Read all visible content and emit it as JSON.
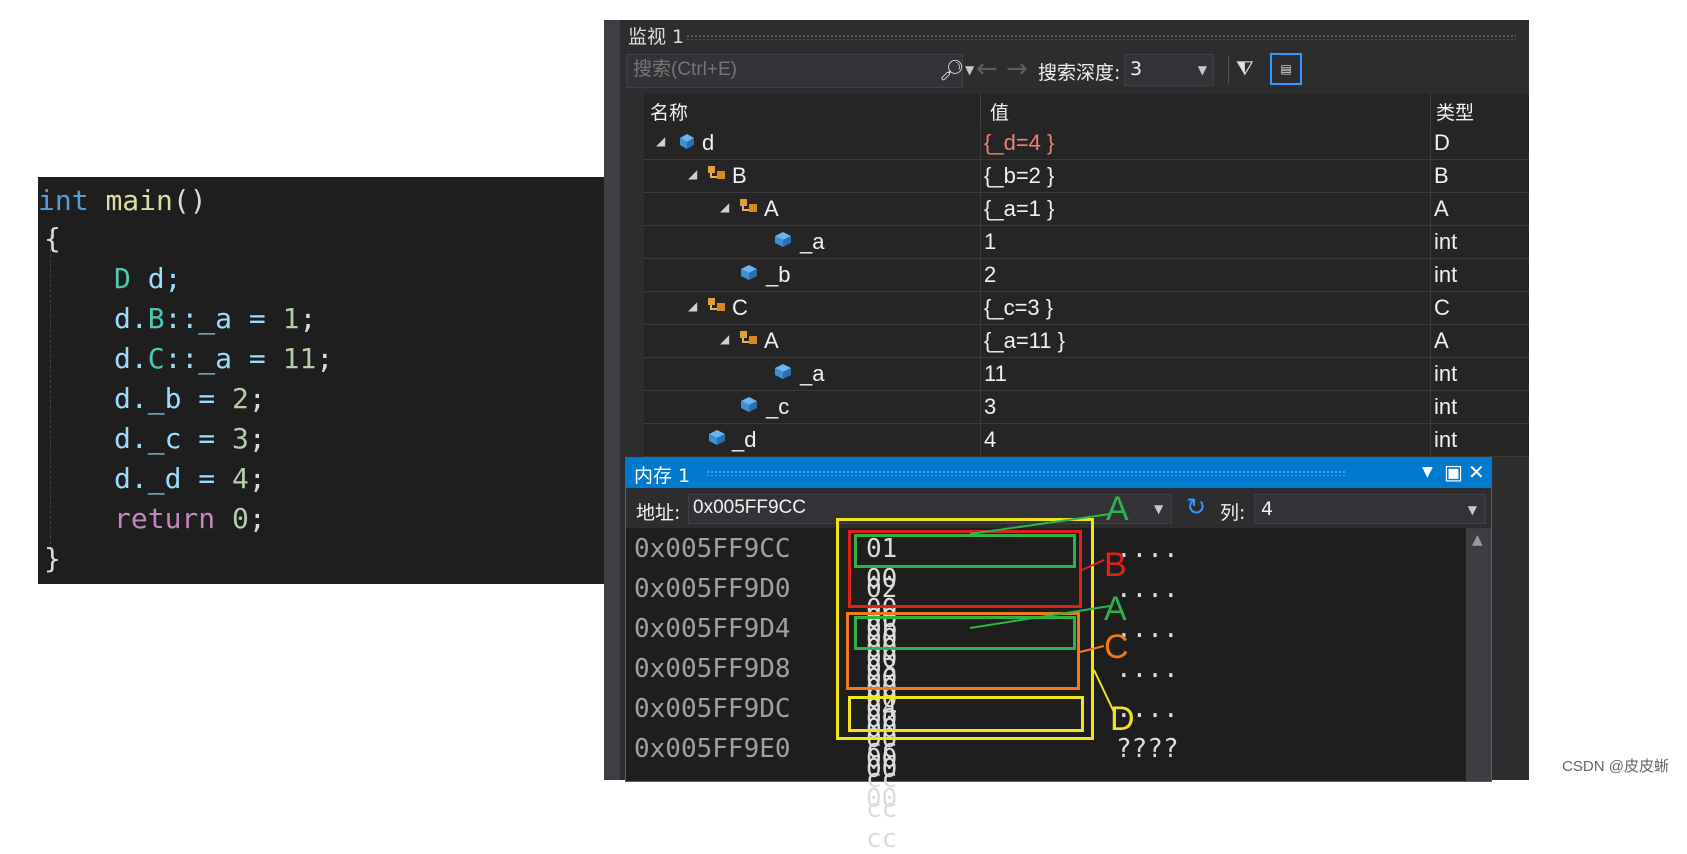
{
  "code": {
    "lines": [
      {
        "type_kw": "int",
        "fn": "main",
        "rest": "()"
      },
      {
        "text": "{"
      },
      {
        "cls": "D",
        "rest": " d;"
      },
      {
        "a": "d.",
        "cls": "B",
        "b": "::_a = ",
        "num": "1",
        "c": ";"
      },
      {
        "a": "d.",
        "cls": "C",
        "b": "::_a = ",
        "num": "11",
        "c": ";"
      },
      {
        "a": "d._b = ",
        "num": "2",
        "c": ";"
      },
      {
        "a": "d._c = ",
        "num": "3",
        "c": ";"
      },
      {
        "a": "d._d = ",
        "num": "4",
        "c": ";"
      },
      {
        "kw": "return",
        "num": "0",
        "c": ";"
      },
      {
        "text": "}"
      }
    ]
  },
  "watch": {
    "title": "监视 1",
    "search_placeholder": "搜索(Ctrl+E)",
    "depth_label": "搜索深度:",
    "depth_value": "3",
    "columns": {
      "name": "名称",
      "value": "值",
      "type": "类型"
    },
    "rows": [
      {
        "name": "d",
        "value": "{_d=4 }",
        "type": "D"
      },
      {
        "name": "B",
        "value": "{_b=2 }",
        "type": "B"
      },
      {
        "name": "A",
        "value": "{_a=1 }",
        "type": "A"
      },
      {
        "name": "_a",
        "value": "1",
        "type": "int"
      },
      {
        "name": "_b",
        "value": "2",
        "type": "int"
      },
      {
        "name": "C",
        "value": "{_c=3 }",
        "type": "C"
      },
      {
        "name": "A",
        "value": "{_a=11 }",
        "type": "A"
      },
      {
        "name": "_a",
        "value": "11",
        "type": "int"
      },
      {
        "name": "_c",
        "value": "3",
        "type": "int"
      },
      {
        "name": "_d",
        "value": "4",
        "type": "int"
      }
    ]
  },
  "memory": {
    "title": "内存 1",
    "address_label": "地址:",
    "address_value": "0x005FF9CC",
    "columns_label": "列:",
    "columns_value": "4",
    "rows": [
      {
        "addr": "0x005FF9CC",
        "bytes": "01 00 00 00",
        "ascii": "...."
      },
      {
        "addr": "0x005FF9D0",
        "bytes": "02 00 00 00",
        "ascii": "...."
      },
      {
        "addr": "0x005FF9D4",
        "bytes": "0b 00 00 00",
        "ascii": "...."
      },
      {
        "addr": "0x005FF9D8",
        "bytes": "03 00 00 00",
        "ascii": "...."
      },
      {
        "addr": "0x005FF9DC",
        "bytes": "04 00 00 00",
        "ascii": "...."
      },
      {
        "addr": "0x005FF9E0",
        "bytes": "cc cc cc cc",
        "ascii": "????"
      }
    ]
  },
  "annotations": {
    "a_top": "A",
    "b": "B",
    "a_mid": "A",
    "c": "C",
    "d": "D",
    "colors": {
      "green": "#2db34a",
      "red": "#e0201b",
      "orange": "#f07a1a",
      "yellow": "#f2e41c"
    }
  },
  "watermark": "CSDN @皮皮蜥"
}
